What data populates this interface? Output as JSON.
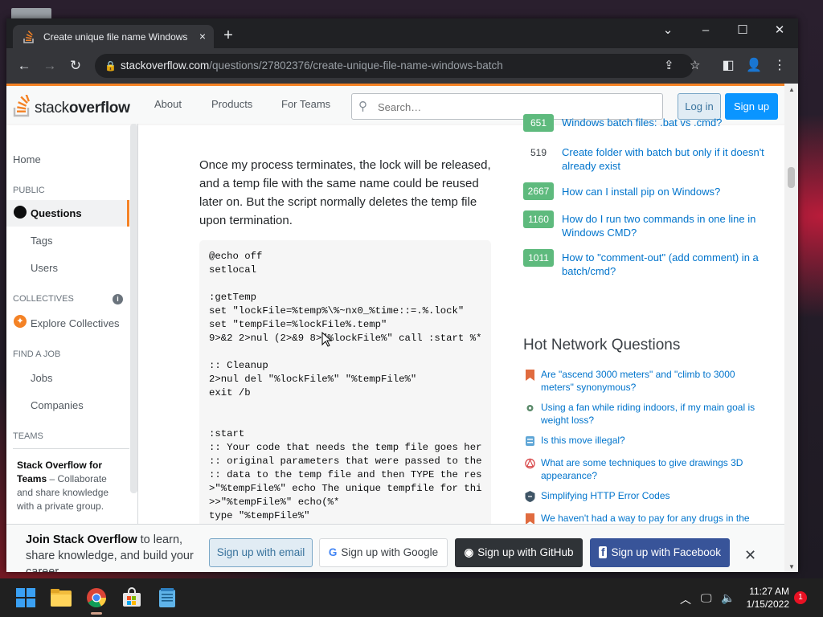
{
  "browser": {
    "tab_title": "Create unique file name Windows batch - Stack Overflow",
    "tab_close": "×",
    "new_tab": "+",
    "url_host": "stackoverflow.com",
    "url_path": "/questions/27802376/create-unique-file-name-windows-batch"
  },
  "header": {
    "logo_light": "stack",
    "logo_bold": "overflow",
    "nav": [
      "About",
      "Products",
      "For Teams"
    ],
    "search_placeholder": "Search…",
    "login": "Log in",
    "signup": "Sign up"
  },
  "sidebar": {
    "home": "Home",
    "public": "PUBLIC",
    "questions": "Questions",
    "tags": "Tags",
    "users": "Users",
    "collectives": "COLLECTIVES",
    "explore_collectives": "Explore Collectives",
    "find_a_job": "FIND A JOB",
    "jobs": "Jobs",
    "companies": "Companies",
    "teams": "TEAMS",
    "teams_title": "Stack Overflow for Teams",
    "teams_desc": " – Collaborate and share knowledge with a private group."
  },
  "main": {
    "paragraph": "Once my process terminates, the lock will be released, and a temp file with the same name could be reused later on. But the script normally deletes the temp file upon termination.",
    "code": "@echo off\nsetlocal\n\n:getTemp\nset \"lockFile=%temp%\\%~nx0_%time::=.%.lock\"\nset \"tempFile=%lockFile%.temp\"\n9>&2 2>nul (2>&9 8>\"%lockFile%\" call :start %*\n\n:: Cleanup\n2>nul del \"%lockFile%\" \"%tempFile%\"\nexit /b\n\n\n:start\n:: Your code that needs the temp file goes her\n:: original parameters that were passed to the\n:: data to the temp file and then TYPE the res\n>\"%tempFile%\" echo The unique tempfile for thi\n>>\"%tempFile%\" echo(%*\ntype \"%tempFile%\""
  },
  "linked": [
    {
      "score": "651",
      "title": "Windows batch files: .bat vs .cmd?",
      "green": true
    },
    {
      "score": "519",
      "title": "Create folder with batch but only if it doesn't already exist",
      "green": false
    },
    {
      "score": "2667",
      "title": "How can I install pip on Windows?",
      "green": true
    },
    {
      "score": "1160",
      "title": "How do I run two commands in one line in Windows CMD?",
      "green": true
    },
    {
      "score": "1011",
      "title": "How to \"comment-out\" (add comment) in a batch/cmd?",
      "green": true
    }
  ],
  "hot_network": {
    "title": "Hot Network Questions",
    "items": [
      "Are \"ascend 3000 meters\" and \"climb to 3000 meters\" synonymous?",
      "Using a fan while riding indoors, if my main goal is weight loss?",
      "Is this move illegal?",
      "What are some techniques to give drawings 3D appearance?",
      "Simplifying HTTP Error Codes",
      "We haven't had a way to pay for any drugs in the past"
    ]
  },
  "banner": {
    "bold": "Join Stack Overflow",
    "rest": " to learn, share knowledge, and build your career.",
    "email": "Sign up with email",
    "google": "Sign up with Google",
    "github": "Sign up with GitHub",
    "facebook": "Sign up with Facebook"
  },
  "taskbar": {
    "time": "11:27 AM",
    "date": "1/15/2022",
    "notifications": "1"
  },
  "colors": {
    "accent": "#f48225",
    "link": "#0074cc",
    "accepted_green": "#5eba7d",
    "primary_button": "#0a95ff"
  }
}
